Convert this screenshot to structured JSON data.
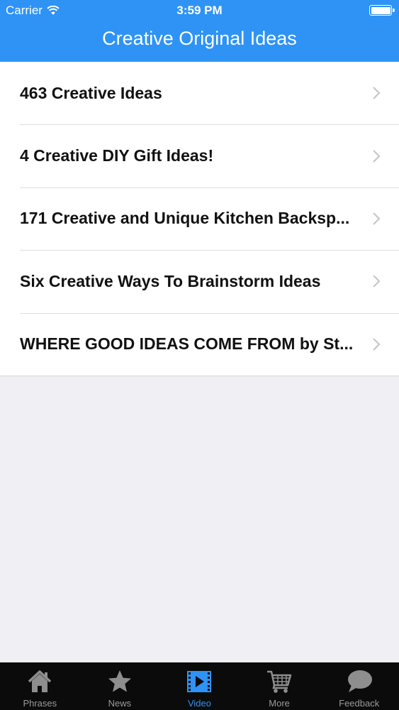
{
  "status": {
    "carrier": "Carrier",
    "time": "3:59 PM"
  },
  "nav": {
    "title": "Creative Original Ideas"
  },
  "list": {
    "items": [
      {
        "title": "463 Creative Ideas"
      },
      {
        "title": "4 Creative DIY Gift Ideas!"
      },
      {
        "title": "171 Creative and Unique Kitchen Backsp..."
      },
      {
        "title": "Six Creative Ways To Brainstorm Ideas"
      },
      {
        "title": "WHERE GOOD IDEAS COME FROM by St..."
      }
    ]
  },
  "tabs": [
    {
      "label": "Phrases",
      "icon": "house-icon"
    },
    {
      "label": "News",
      "icon": "star-icon"
    },
    {
      "label": "Video",
      "icon": "film-icon",
      "active": true
    },
    {
      "label": "More",
      "icon": "cart-icon"
    },
    {
      "label": "Feedback",
      "icon": "speech-bubble-icon"
    }
  ],
  "colors": {
    "accent": "#2e93f5",
    "tabbar": "#0b0b0b",
    "background": "#efeff4",
    "inactive": "#9a9a9a"
  }
}
